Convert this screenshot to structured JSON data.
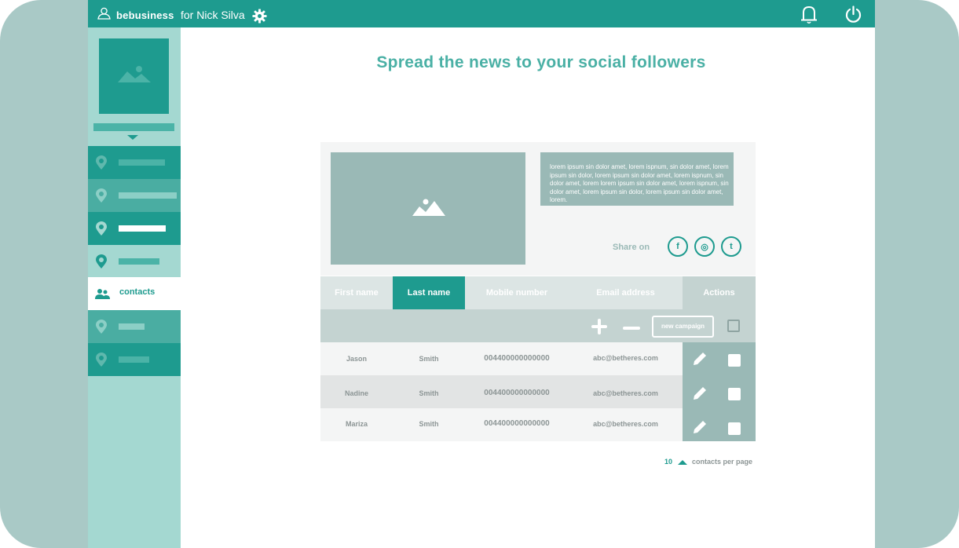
{
  "app": {
    "brand": "bebusiness",
    "user_label": "for Nick Silva"
  },
  "sidebar": {
    "active_label": "contacts"
  },
  "main": {
    "title": "Spread the news to your social followers",
    "card_text": "lorem ipsum sin dolor amet, lorem ispnum, sin dolor amet, lorem ipsum sin dolor, lorem ipsum sin dolor amet, lorem ispnum, sin dolor amet, lorem lorem ipsum sin dolor amet, lorem ispnum, sin dolor amet, lorem ipsum sin dolor, lorem ipsum sin dolor amet, lorem.",
    "share_label": "Share on",
    "social": [
      "f",
      "◎",
      "t"
    ]
  },
  "table": {
    "columns": [
      "First name",
      "Last name",
      "Mobile number",
      "Email address",
      "Actions"
    ],
    "new_campaign": "new campaign",
    "rows": [
      {
        "first": "Jason",
        "last": "Smith",
        "mobile": "004400000000000",
        "email": "abc@betheres.com"
      },
      {
        "first": "Nadine",
        "last": "Smith",
        "mobile": "004400000000000",
        "email": "abc@betheres.com"
      },
      {
        "first": "Mariza",
        "last": "Smith",
        "mobile": "004400000000000",
        "email": "abc@betheres.com"
      }
    ]
  },
  "pagination": {
    "count": "10",
    "label": "contacts per page"
  },
  "colors": {
    "primary": "#1e9b8f",
    "sidebar": "#a4d8d1",
    "muted": "#9ab9b6",
    "frame": "#a9c9c6"
  }
}
